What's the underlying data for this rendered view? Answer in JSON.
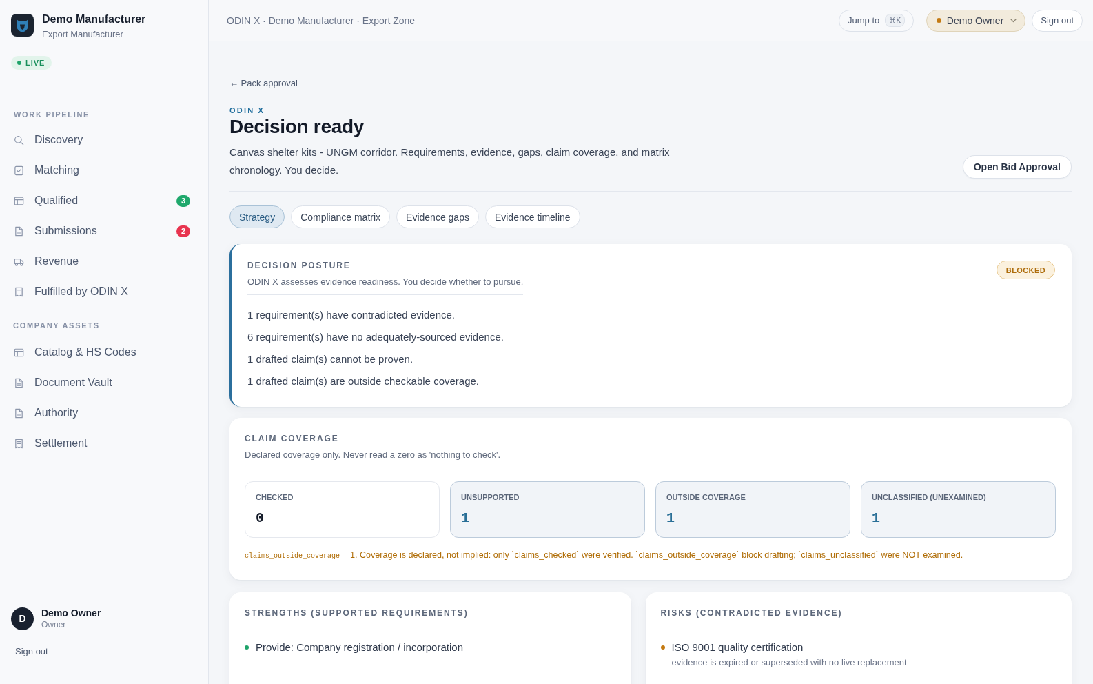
{
  "sidebar": {
    "org": {
      "name": "Demo Manufacturer",
      "subtitle": "Export Manufacturer"
    },
    "status": "LIVE",
    "sections": [
      {
        "heading": "WORK PIPELINE",
        "items": [
          {
            "label": "Discovery",
            "selected": false
          },
          {
            "label": "Matching",
            "selected": false
          },
          {
            "label": "Qualified",
            "selected": false,
            "badge": {
              "text": "3",
              "color": "#1fa86c"
            }
          },
          {
            "label": "Submissions",
            "selected": false,
            "badge": {
              "text": "2",
              "color": "#e8344f"
            }
          },
          {
            "label": "Revenue",
            "selected": false
          },
          {
            "label": "Fulfilled by ODIN X",
            "selected": false
          }
        ]
      },
      {
        "heading": "COMPANY ASSETS",
        "items": [
          {
            "label": "Catalog & HS Codes",
            "selected": false
          },
          {
            "label": "Document Vault",
            "selected": false
          },
          {
            "label": "Authority",
            "selected": false
          },
          {
            "label": "Settlement",
            "selected": false
          }
        ]
      }
    ],
    "user": {
      "initial": "D",
      "name": "Demo Owner",
      "role": "Owner"
    },
    "sign_out": "Sign out"
  },
  "topbar": {
    "breadcrumb": "ODIN X · Demo Manufacturer · Export Zone",
    "jump": {
      "label": "Jump to",
      "shortcut": "⌘K"
    },
    "user_menu": "Demo Owner",
    "sign_out": "Sign out"
  },
  "header": {
    "back_link": "← Pack approval",
    "eyebrow": "ODIN X",
    "title": "Decision ready",
    "description": "Canvas shelter kits - UNGM corridor. Requirements, evidence, gaps, claim coverage, and matrix chronology. You decide.",
    "action": "Open Bid Approval"
  },
  "tabs": [
    {
      "label": "Strategy",
      "selected": true
    },
    {
      "label": "Compliance matrix",
      "selected": false
    },
    {
      "label": "Evidence gaps",
      "selected": false
    },
    {
      "label": "Evidence timeline",
      "selected": false
    }
  ],
  "posture": {
    "heading": "DECISION POSTURE",
    "subtitle": "ODIN X assesses evidence readiness. You decide whether to pursue.",
    "status": "BLOCKED",
    "findings": [
      "1 requirement(s) have contradicted evidence.",
      "6 requirement(s) have no adequately-sourced evidence.",
      "1 drafted claim(s) cannot be proven.",
      "1 drafted claim(s) are outside checkable coverage."
    ]
  },
  "coverage": {
    "heading": "CLAIM COVERAGE",
    "subtitle": "Declared coverage only. Never read a zero as 'nothing to check'.",
    "stats": [
      {
        "label": "CHECKED",
        "value": "0",
        "flagged": false
      },
      {
        "label": "UNSUPPORTED",
        "value": "1",
        "flagged": true
      },
      {
        "label": "OUTSIDE COVERAGE",
        "value": "1",
        "flagged": true
      },
      {
        "label": "UNCLASSIFIED (UNEXAMINED)",
        "value": "1",
        "flagged": true
      }
    ],
    "note": {
      "code": "claims_outside_coverage",
      "text": "= 1. Coverage is declared, not implied: only `claims_checked` were verified. `claims_outside_coverage` block drafting; `claims_unclassified` were NOT examined."
    }
  },
  "panels": [
    {
      "heading": "STRENGTHS (SUPPORTED REQUIREMENTS)",
      "color": "#1fa36a",
      "items": [
        {
          "title": "Provide: Company registration / incorporation"
        }
      ]
    },
    {
      "heading": "RISKS (CONTRADICTED EVIDENCE)",
      "color": "#c47a12",
      "items": [
        {
          "title": "ISO 9001 quality certification",
          "detail": "evidence is expired or superseded with no live replacement"
        }
      ]
    }
  ]
}
